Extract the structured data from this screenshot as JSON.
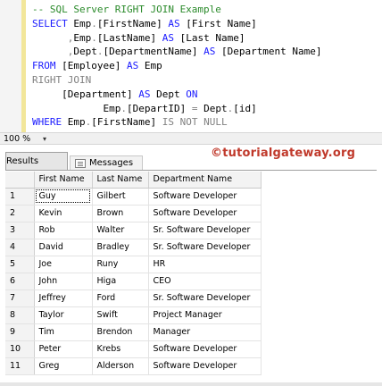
{
  "editor": {
    "lines": [
      [
        {
          "t": "-- SQL Server RIGHT JOIN Example",
          "c": "cm"
        }
      ],
      [
        {
          "t": "SELECT ",
          "c": "kw"
        },
        {
          "t": "Emp",
          "c": ""
        },
        {
          "t": ".",
          "c": "op"
        },
        {
          "t": "[FirstName] ",
          "c": ""
        },
        {
          "t": "AS ",
          "c": "kw"
        },
        {
          "t": "[First Name]",
          "c": ""
        }
      ],
      [
        {
          "t": "      ,",
          "c": "op"
        },
        {
          "t": "Emp",
          "c": ""
        },
        {
          "t": ".",
          "c": "op"
        },
        {
          "t": "[LastName] ",
          "c": ""
        },
        {
          "t": "AS ",
          "c": "kw"
        },
        {
          "t": "[Last Name]",
          "c": ""
        }
      ],
      [
        {
          "t": "      ,",
          "c": "op"
        },
        {
          "t": "Dept",
          "c": ""
        },
        {
          "t": ".",
          "c": "op"
        },
        {
          "t": "[DepartmentName] ",
          "c": ""
        },
        {
          "t": "AS ",
          "c": "kw"
        },
        {
          "t": "[Department Name]",
          "c": ""
        }
      ],
      [
        {
          "t": "FROM ",
          "c": "kw"
        },
        {
          "t": "[Employee] ",
          "c": ""
        },
        {
          "t": "AS ",
          "c": "kw"
        },
        {
          "t": "Emp",
          "c": ""
        }
      ],
      [
        {
          "t": "RIGHT JOIN",
          "c": "op"
        }
      ],
      [
        {
          "t": "     ",
          "c": ""
        },
        {
          "t": "[Department] ",
          "c": ""
        },
        {
          "t": "AS ",
          "c": "kw"
        },
        {
          "t": "Dept ",
          "c": ""
        },
        {
          "t": "ON",
          "c": "kw"
        }
      ],
      [
        {
          "t": "            ",
          "c": ""
        },
        {
          "t": "Emp",
          "c": ""
        },
        {
          "t": ".",
          "c": "op"
        },
        {
          "t": "[DepartID] ",
          "c": ""
        },
        {
          "t": "= ",
          "c": "op"
        },
        {
          "t": "Dept",
          "c": ""
        },
        {
          "t": ".",
          "c": "op"
        },
        {
          "t": "[id]",
          "c": ""
        }
      ],
      [
        {
          "t": "WHERE ",
          "c": "kw"
        },
        {
          "t": "Emp",
          "c": ""
        },
        {
          "t": ".",
          "c": "op"
        },
        {
          "t": "[FirstName] ",
          "c": ""
        },
        {
          "t": "IS NOT NULL",
          "c": "op"
        }
      ]
    ]
  },
  "zoom": {
    "value": "100 %",
    "arrow": "▾"
  },
  "watermark": "©tutorialgateway.org",
  "tabs": {
    "results": "Results",
    "messages": "Messages"
  },
  "grid": {
    "columns": [
      "",
      "First Name",
      "Last Name",
      "Department Name"
    ],
    "rows": [
      [
        "1",
        "Guy",
        "Gilbert",
        "Software Developer"
      ],
      [
        "2",
        "Kevin",
        "Brown",
        "Software Developer"
      ],
      [
        "3",
        "Rob",
        "Walter",
        "Sr. Software Developer"
      ],
      [
        "4",
        "David",
        "Bradley",
        "Sr. Software Developer"
      ],
      [
        "5",
        "Joe",
        "Runy",
        "HR"
      ],
      [
        "6",
        "John",
        "Higa",
        "CEO"
      ],
      [
        "7",
        "Jeffrey",
        "Ford",
        "Sr. Software Developer"
      ],
      [
        "8",
        "Taylor",
        "Swift",
        "Project Manager"
      ],
      [
        "9",
        "Tim",
        "Brendon",
        "Manager"
      ],
      [
        "10",
        "Peter",
        "Krebs",
        "Software Developer"
      ],
      [
        "11",
        "Greg",
        "Alderson",
        "Software Developer"
      ]
    ]
  }
}
